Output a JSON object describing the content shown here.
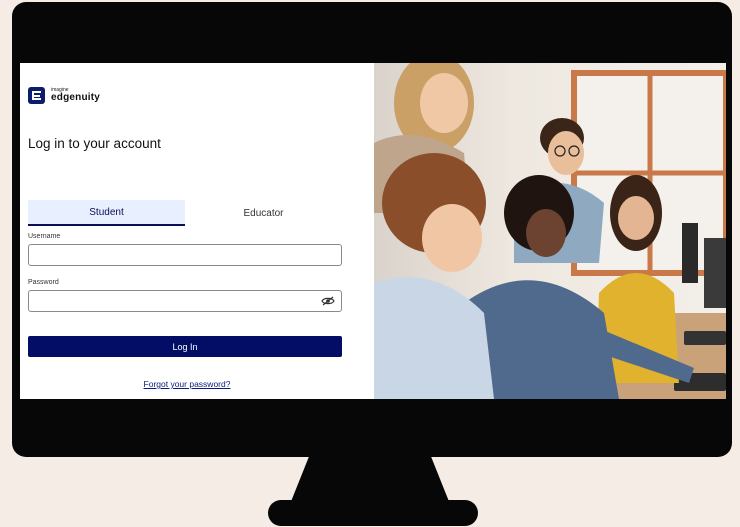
{
  "brand": {
    "small": "imagine",
    "name": "edgenuity"
  },
  "login": {
    "heading": "Log in to your account",
    "tabs": [
      {
        "label": "Student",
        "active": true
      },
      {
        "label": "Educator",
        "active": false
      }
    ],
    "username_label": "Username",
    "username_value": "",
    "password_label": "Password",
    "password_value": "",
    "submit_label": "Log In",
    "forgot_label": "Forgot your password?"
  },
  "icons": {
    "logo": "edgenuity-logo-icon",
    "password_toggle": "eye-slash-icon"
  },
  "colors": {
    "accent": "#040d66",
    "tab_active_bg": "#e8effe",
    "page_bg": "#f6ece6",
    "monitor": "#070707"
  },
  "photo": {
    "subject": "students-at-computers"
  }
}
